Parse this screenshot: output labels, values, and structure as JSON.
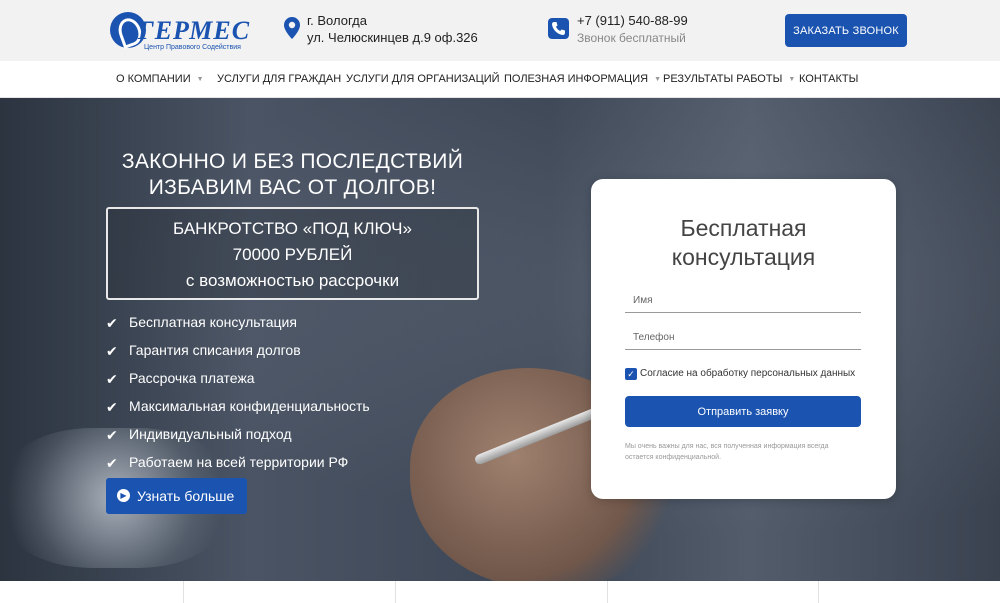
{
  "brand": {
    "name": "ГЕРМЕС",
    "subtitle": "Центр Правового Содействия",
    "color": "#1b53b0"
  },
  "header": {
    "address_icon": "map-pin-icon",
    "address_city": "г. Вологда",
    "address_street": "ул. Челюскинцев д.9 оф.326",
    "phone_icon": "phone-icon",
    "phone": "+7 (911) 540-88-99",
    "phone_note": "Звонок бесплатный",
    "call_button": "ЗАКАЗАТЬ ЗВОНОК"
  },
  "nav": {
    "items": [
      {
        "label": "О КОМПАНИИ",
        "dropdown": true
      },
      {
        "label": "УСЛУГИ ДЛЯ ГРАЖДАН",
        "dropdown": false
      },
      {
        "label": "УСЛУГИ ДЛЯ ОРГАНИЗАЦИЙ",
        "dropdown": false
      },
      {
        "label": "ПОЛЕЗНАЯ ИНФОРМАЦИЯ",
        "dropdown": true
      },
      {
        "label": "РЕЗУЛЬТАТЫ РАБОТЫ",
        "dropdown": true
      },
      {
        "label": "КОНТАКТЫ",
        "dropdown": false
      }
    ],
    "caret": "▼"
  },
  "hero": {
    "headline_line1": "ЗАКОННО И БЕЗ ПОСЛЕДСТВИЙ",
    "headline_line2": "ИЗБАВИМ ВАС ОТ ДОЛГОВ!",
    "offer_line1": "БАНКРОТСТВО «ПОД КЛЮЧ»",
    "offer_line2": "70000 РУБЛЕЙ",
    "offer_line3": "с возможностью рассрочки",
    "check_glyph": "✔",
    "features": [
      "Бесплатная консультация",
      "Гарантия списания долгов",
      "Рассрочка платежа",
      "Максимальная конфиденциальность",
      "Индивидуальный подход",
      "Работаем на всей территории РФ"
    ],
    "learn_more": "Узнать больше",
    "learn_icon": "▶"
  },
  "form": {
    "title_line1": "Бесплатная",
    "title_line2": "консультация",
    "name_placeholder": "Имя",
    "phone_placeholder": "Телефон",
    "consent_checked": true,
    "consent_glyph": "✓",
    "consent_label": "Согласие на обработку персональных данных",
    "submit": "Отправить заявку",
    "privacy_line1": "Мы очень важны для нас, вся полученная информация всегда",
    "privacy_line2": "остается конфиденциальной."
  }
}
